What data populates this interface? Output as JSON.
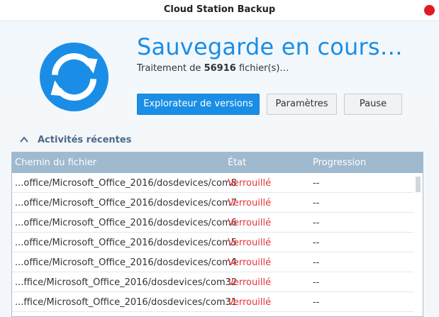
{
  "window": {
    "title": "Cloud Station Backup"
  },
  "header": {
    "headline": "Sauvegarde en cours…",
    "status_prefix": "Traitement de",
    "file_count": "56916",
    "status_suffix": "fichier(s)…",
    "logo_icon": "sync-icon"
  },
  "buttons": {
    "versions_label": "Explorateur de versions",
    "settings_label": "Paramètres",
    "pause_label": "Pause"
  },
  "recent": {
    "title": "Activités récentes",
    "columns": {
      "path": "Chemin du fichier",
      "state": "État",
      "progress": "Progression"
    },
    "rows": [
      {
        "path": "...office/Microsoft_Office_2016/dosdevices/com8",
        "state": "Verrouillé",
        "progress": "--"
      },
      {
        "path": "...office/Microsoft_Office_2016/dosdevices/com7",
        "state": "Verrouillé",
        "progress": "--"
      },
      {
        "path": "...office/Microsoft_Office_2016/dosdevices/com6",
        "state": "Verrouillé",
        "progress": "--"
      },
      {
        "path": "...office/Microsoft_Office_2016/dosdevices/com5",
        "state": "Verrouillé",
        "progress": "--"
      },
      {
        "path": "...office/Microsoft_Office_2016/dosdevices/com4",
        "state": "Verrouillé",
        "progress": "--"
      },
      {
        "path": "...ffice/Microsoft_Office_2016/dosdevices/com32",
        "state": "Verrouillé",
        "progress": "--"
      },
      {
        "path": "...ffice/Microsoft_Office_2016/dosdevices/com31",
        "state": "Verrouillé",
        "progress": "--"
      }
    ]
  },
  "colors": {
    "accent": "#1a8ee6",
    "locked": "#e4353b",
    "header_bg": "#9fb9cf",
    "close": "#e01b24"
  }
}
